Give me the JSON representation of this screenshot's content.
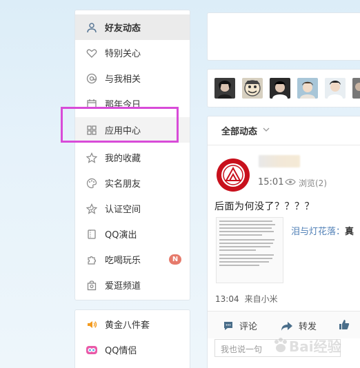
{
  "sidebar": {
    "items": [
      {
        "label": "好友动态",
        "icon": "person-icon",
        "active": true
      },
      {
        "label": "特别关心",
        "icon": "heart-icon"
      },
      {
        "label": "与我相关",
        "icon": "at-icon"
      },
      {
        "label": "那年今日",
        "icon": "calendar-icon"
      },
      {
        "label": "应用中心",
        "icon": "grid-icon"
      },
      {
        "label": "我的收藏",
        "icon": "star-icon"
      },
      {
        "label": "实名朋友",
        "icon": "palette-icon"
      },
      {
        "label": "认证空间",
        "icon": "badge-star-icon"
      },
      {
        "label": "QQ演出",
        "icon": "ticket-icon"
      },
      {
        "label": "吃喝玩乐",
        "icon": "puzzle-icon",
        "badge": "N"
      },
      {
        "label": "爱逛频道",
        "icon": "bag-icon"
      }
    ]
  },
  "apps": [
    {
      "label": "黄金八件套",
      "icon": "sound-icon"
    },
    {
      "label": "QQ情侣",
      "icon": "couple-icon"
    }
  ],
  "feed": {
    "header": "全部动态",
    "post": {
      "time": "15:01",
      "views": "浏览(2)",
      "text": "后面为何没了？？？？",
      "link_author": "泪与灯花落：",
      "link_tail": "真",
      "footer_time": "13:04",
      "footer_source": "来自小米"
    },
    "actions": {
      "comment": "评论",
      "share": "转发"
    },
    "comment_placeholder": "我也说一句"
  },
  "watermark": "Bai经验",
  "colors": {
    "highlight_box": "#d84bd8",
    "badge": "#e67a6b",
    "link": "#4f7fb6"
  }
}
